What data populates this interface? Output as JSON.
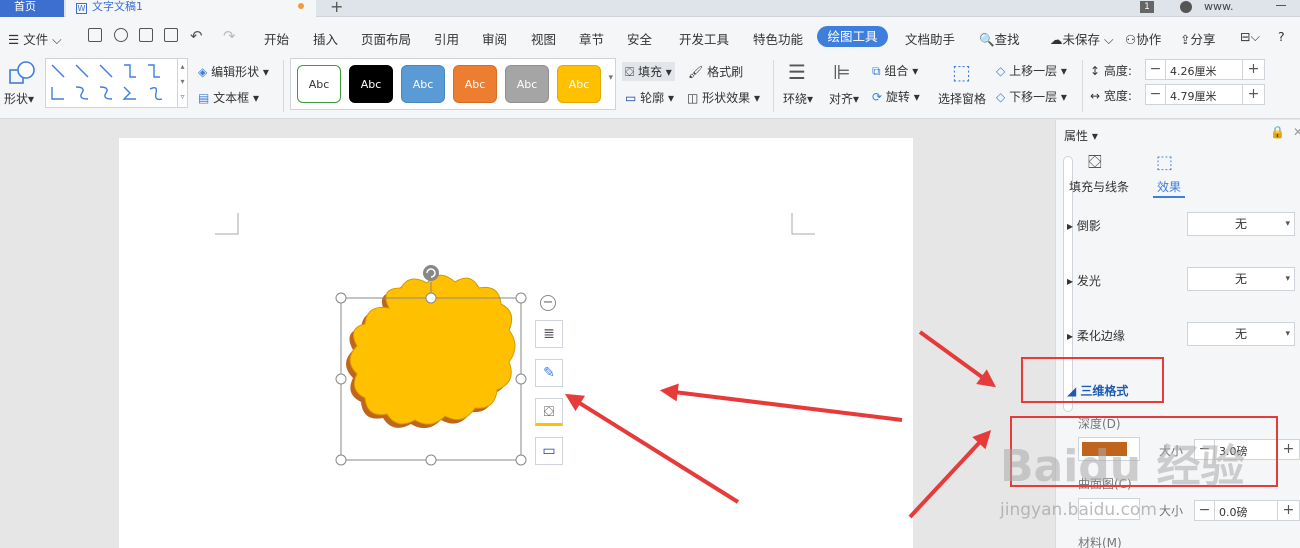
{
  "tabs": {
    "home": "首页",
    "doc": "文字文稿1",
    "add": "+"
  },
  "titlebar": {
    "page_num": "1",
    "account": "www."
  },
  "menu": {
    "file": "文件",
    "items": [
      "开始",
      "插入",
      "页面布局",
      "引用",
      "审阅",
      "视图",
      "章节",
      "安全",
      "开发工具",
      "特色功能"
    ],
    "active": "绘图工具",
    "after": [
      "文档助手"
    ],
    "search": "查找",
    "unsaved": "未保存",
    "collab": "协作",
    "share": "分享",
    "help": "?"
  },
  "ribbon": {
    "shape": "形状",
    "edit_shape": "编辑形状",
    "textbox": "文本框",
    "styles": [
      {
        "label": "Abc",
        "bg": "#ffffff",
        "fg": "#333333",
        "border": "#3c9a3c"
      },
      {
        "label": "Abc",
        "bg": "#000000",
        "fg": "#ffffff",
        "border": "#000000"
      },
      {
        "label": "Abc",
        "bg": "#5b9bd5",
        "fg": "#ffffff",
        "border": "#4a86c0"
      },
      {
        "label": "Abc",
        "bg": "#ed7d31",
        "fg": "#ffffff",
        "border": "#d46d26"
      },
      {
        "label": "Abc",
        "bg": "#a5a5a5",
        "fg": "#ffffff",
        "border": "#8f8f8f"
      },
      {
        "label": "Abc",
        "bg": "#ffc000",
        "fg": "#ffffff",
        "border": "#e0a800"
      }
    ],
    "fill": "填充",
    "format_painter": "格式刷",
    "outline": "轮廓",
    "shape_effect": "形状效果",
    "wrap": "环绕",
    "align": "对齐",
    "group": "组合",
    "rotate": "旋转",
    "select_pane": "选择窗格",
    "bring_forward": "上移一层",
    "send_backward": "下移一层",
    "height_label": "高度:",
    "height_value": "4.26厘米",
    "width_label": "宽度:",
    "width_value": "4.79厘米"
  },
  "panel": {
    "title": "属性",
    "tab_fill": "填充与线条",
    "tab_effect": "效果",
    "shadow": "倒影",
    "shadow_value": "无",
    "glow": "发光",
    "glow_value": "无",
    "soft_edge": "柔化边缘",
    "soft_edge_value": "无",
    "three_d": "三维格式",
    "depth": "深度(D)",
    "depth_size_label": "大小",
    "depth_value": "3.0磅",
    "contour": "曲面图(C)",
    "contour_size_label": "大小",
    "contour_value": "0.0磅",
    "material": "材料(M)"
  },
  "watermark": {
    "logo": "Baidu 经验",
    "url": "jingyan.baidu.com"
  },
  "colors": {
    "accent": "#3e7fdd",
    "shape_fill": "#ffc000",
    "arrow": "#e53b3b",
    "depth_color": "#c0651e"
  }
}
